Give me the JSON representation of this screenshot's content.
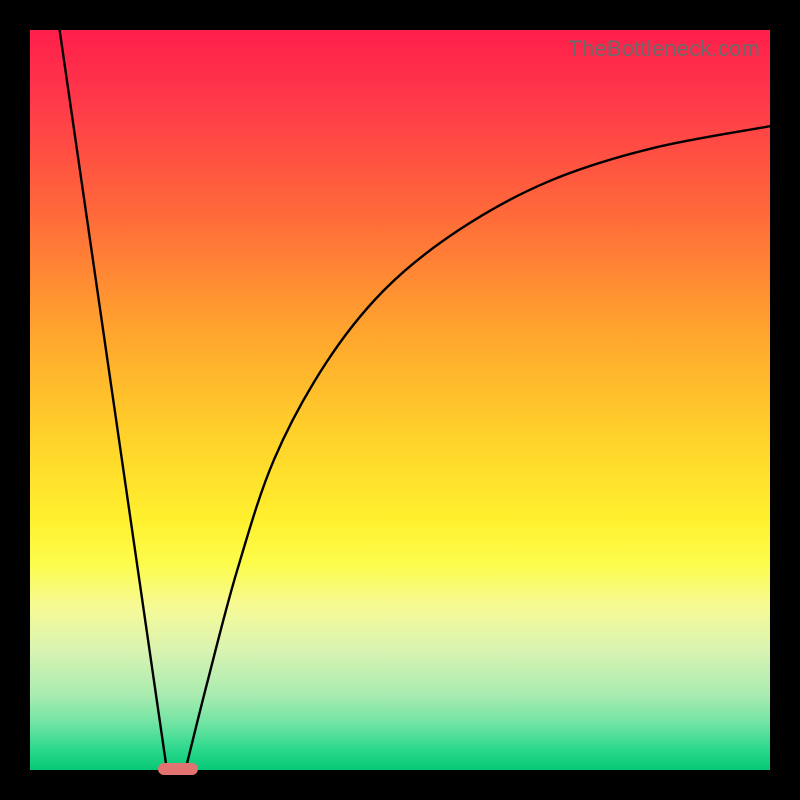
{
  "watermark": "TheBottleneck.com",
  "chart_data": {
    "type": "line",
    "title": "",
    "xlabel": "",
    "ylabel": "",
    "xlim": [
      0,
      100
    ],
    "ylim": [
      0,
      100
    ],
    "grid": false,
    "series": [
      {
        "name": "left-slope",
        "x": [
          4,
          18.5
        ],
        "values": [
          100,
          0
        ]
      },
      {
        "name": "right-curve",
        "x": [
          21,
          24,
          28,
          33,
          40,
          48,
          58,
          70,
          84,
          100
        ],
        "values": [
          0,
          12,
          27,
          42,
          55,
          65,
          73,
          79.5,
          84,
          87
        ]
      }
    ],
    "marker": {
      "name": "bottleneck-pill",
      "x": 20,
      "y": 0,
      "color": "#e17371"
    },
    "background_gradient": {
      "top": "#ff1f4b",
      "mid": "#ffe430",
      "bottom": "#06c876"
    }
  }
}
